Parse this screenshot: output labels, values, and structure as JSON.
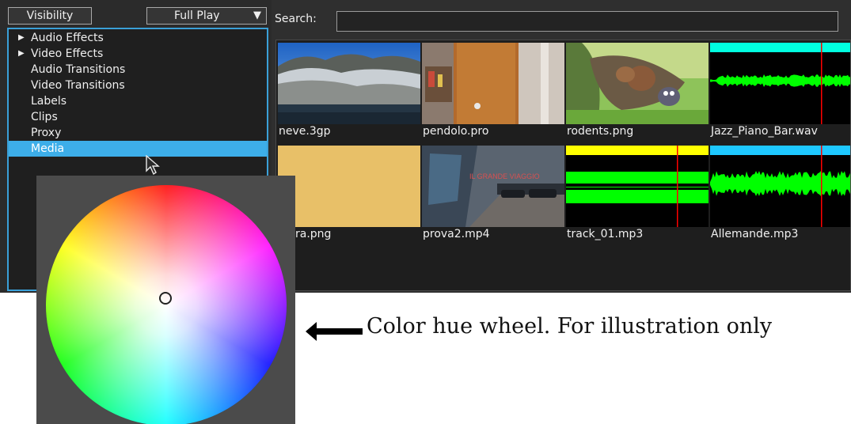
{
  "left_panel": {
    "visibility_label": "Visibility",
    "play_mode": "Full Play",
    "tree": [
      {
        "label": "Audio Effects",
        "expandable": true
      },
      {
        "label": "Video Effects",
        "expandable": true
      },
      {
        "label": "Audio Transitions",
        "expandable": false
      },
      {
        "label": "Video Transitions",
        "expandable": false
      },
      {
        "label": "Labels",
        "expandable": false
      },
      {
        "label": "Clips",
        "expandable": false
      },
      {
        "label": "Proxy",
        "expandable": false
      },
      {
        "label": "Media",
        "expandable": false,
        "selected": true
      }
    ]
  },
  "search": {
    "label": "Search:",
    "value": "",
    "placeholder": ""
  },
  "media": {
    "items": [
      {
        "label": "neve.3gp"
      },
      {
        "label": "pendolo.pro"
      },
      {
        "label": "rodents.png"
      },
      {
        "label": "Jazz_Piano_Bar.wav"
      },
      {
        "label": "ra.png"
      },
      {
        "label": "prova2.mp4"
      },
      {
        "label": "track_01.mp3"
      },
      {
        "label": "Allemande.mp3"
      }
    ]
  },
  "thumb_text": {
    "prova2_overlay": "IL GRANDE VIAGGIO"
  },
  "caption": {
    "text": "Color hue wheel. For illustration only"
  },
  "colors": {
    "selection": "#3daee9",
    "tree_border": "#3aa0d8",
    "audio_wave": "#00ff00",
    "jazz_bar": "#00ffe0",
    "track_bar": "#ffff00",
    "allemande_bar": "#1ec8ff",
    "cursor_line": "#ff0000"
  }
}
